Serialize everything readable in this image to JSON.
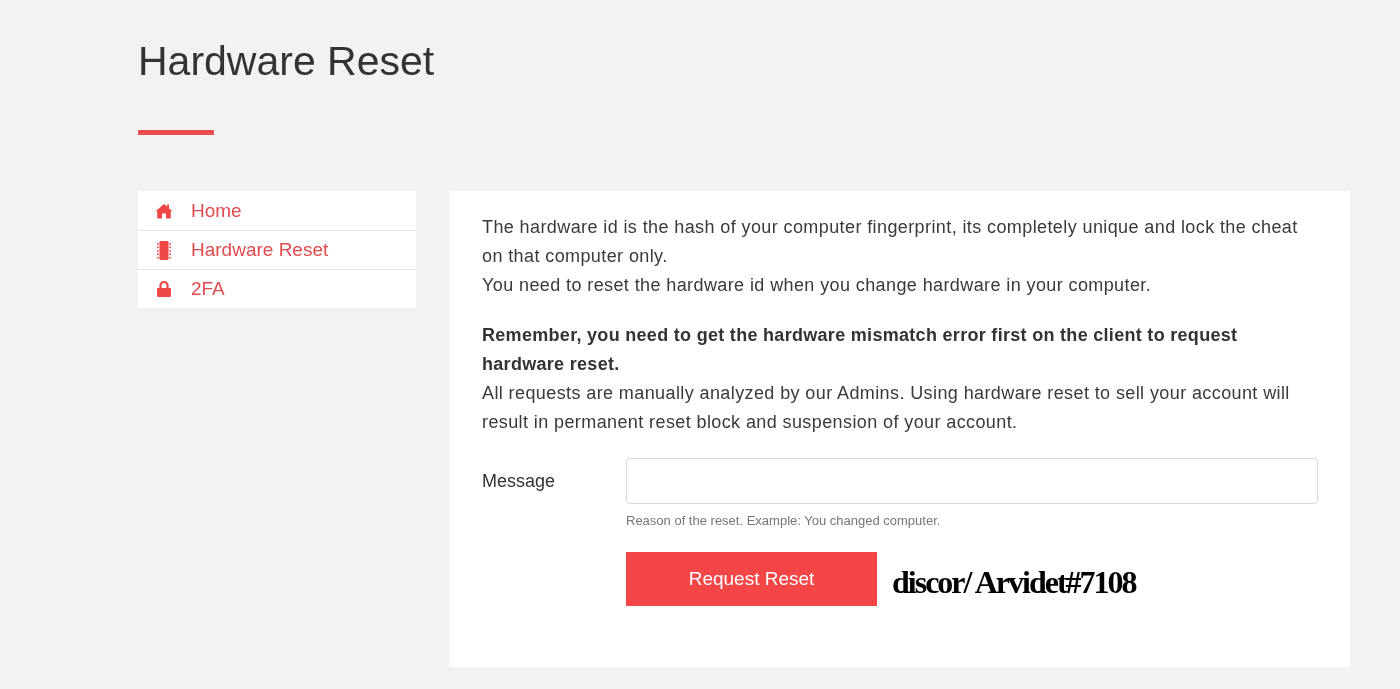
{
  "page": {
    "title": "Hardware Reset"
  },
  "sidebar": {
    "items": [
      {
        "label": "Home"
      },
      {
        "label": "Hardware Reset"
      },
      {
        "label": "2FA"
      }
    ]
  },
  "content": {
    "paragraphs": [
      [
        {
          "kind": "plain",
          "text": "The hardware id is the hash of your computer fingerprint, its completely unique and lock the cheat on that computer only."
        },
        {
          "kind": "plain",
          "text": "You need to reset the hardware id when you change hardware in your computer."
        }
      ],
      [
        {
          "kind": "strong",
          "text": "Remember, you need to get the hardware mismatch error first on the client to request hardware reset."
        },
        {
          "kind": "plain",
          "text": "All requests are manually analyzed by our Admins. Using hardware reset to sell your account will result in permanent reset block and suspension of your account."
        }
      ]
    ],
    "form": {
      "label": "Message",
      "help": "Reason of the reset. Example: You changed computer.",
      "button": "Request Reset"
    }
  },
  "overlay_note": "discor/ Arvidet#7108"
}
